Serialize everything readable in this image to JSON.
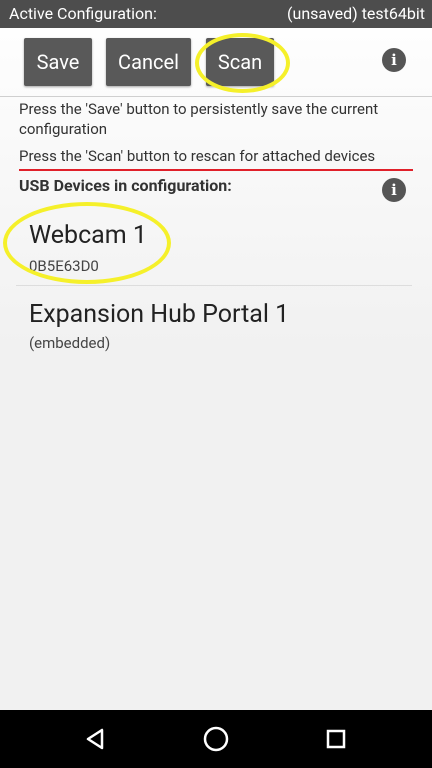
{
  "status_bar": {
    "title": "Active Configuration:",
    "config_name": "(unsaved) test64bit"
  },
  "toolbar": {
    "save_label": "Save",
    "cancel_label": "Cancel",
    "scan_label": "Scan",
    "info_label": "i"
  },
  "help": {
    "save_text": "Press the 'Save' button to persistently save the current configuration",
    "scan_text": "Press the 'Scan' button to rescan for attached devices"
  },
  "usb_section": {
    "title": "USB Devices in configuration:",
    "info_label": "i"
  },
  "devices": [
    {
      "name": "Webcam 1",
      "serial": "0B5E63D0"
    },
    {
      "name": "Expansion Hub Portal 1",
      "serial": "(embedded)"
    }
  ],
  "colors": {
    "accent_underline": "#e0202a",
    "highlight": "#f5f02a",
    "button_bg": "#595959",
    "status_bar_bg": "#4d4d4d"
  },
  "icons": {
    "info": "info-icon",
    "back": "back-triangle-icon",
    "home": "home-circle-icon",
    "recent": "recent-apps-square-icon"
  }
}
